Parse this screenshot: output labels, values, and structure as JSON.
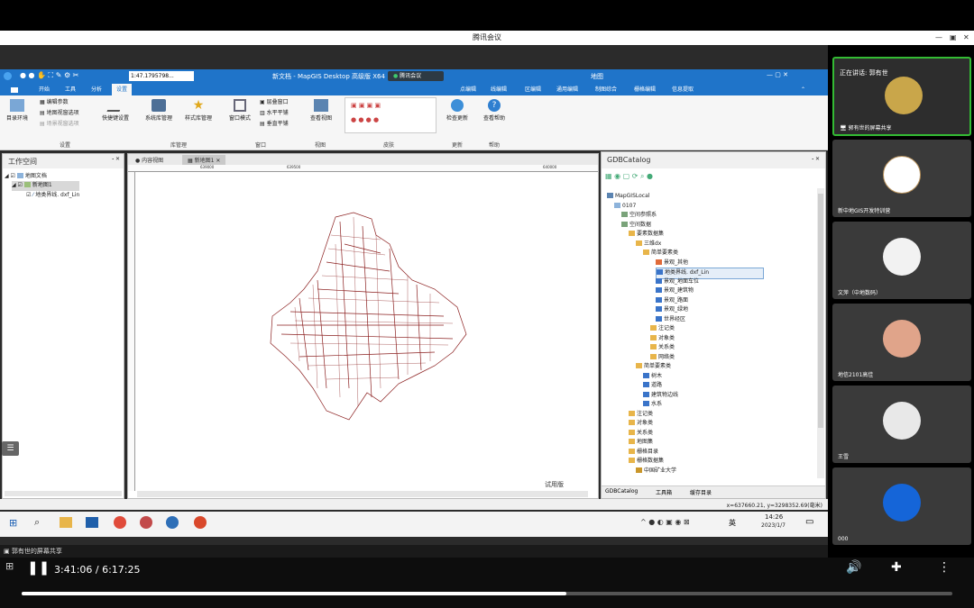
{
  "meeting": {
    "title": "腾讯会议",
    "speaking_label": "正在讲话: 郭有世",
    "sharer": "郭有世的屏幕共享",
    "sharer_bottom": "郭有世的屏幕共享"
  },
  "mapgis": {
    "window_title": "新文档 - MapGIS Desktop 高级版 X64",
    "meeting_badge": "腾讯会议",
    "right_title": "地图",
    "scale": "1:47.1795798...",
    "menu": [
      "开始",
      "工具",
      "分析",
      "设置"
    ],
    "right_menu": [
      "点编辑",
      "线编辑",
      "区编辑",
      "通用编辑",
      "制图综合",
      "栅格编辑",
      "信息提取"
    ],
    "ribbon": {
      "b1": "目录环境",
      "b2": "编辑参数",
      "b3": "地图视窗选项",
      "b4": "场景视窗选项",
      "b5": "快捷键设置",
      "b6": "系统库管理",
      "b7": "样式库管理",
      "b8": "窗口模式",
      "b9": "层叠窗口",
      "b10": "水平平铺",
      "b11": "垂直平铺",
      "b12": "查看视图",
      "b13": "检查更新",
      "b14": "查看帮助",
      "g1": "设置",
      "g2": "库管理",
      "g3": "窗口",
      "g4": "视图",
      "g5": "皮肤",
      "g6": "更新",
      "g7": "帮助"
    },
    "workspace": {
      "title": "工作空间",
      "items": [
        "地图文档",
        "新地图1",
        "地类界线. dxf_Lin"
      ]
    },
    "tabs": [
      "内容视图",
      "新地图1"
    ],
    "ruler": [
      "639000",
      "639500",
      "640000"
    ],
    "map_label": "试用版",
    "catalog": {
      "title": "GDBCatalog",
      "items": [
        "MapGISLocal",
        "0107",
        "空间参照系",
        "空间数据",
        "要素数据集",
        "三维dx",
        "简单要素类",
        "景观_其他",
        "地类界线. dxf_Lin",
        "景观_地面车位",
        "景观_建筑物",
        "景观_路面",
        "景观_绿地",
        "世界经区",
        "注记类",
        "对象类",
        "关系类",
        "网络类",
        "简单要素类",
        "树木",
        "道路",
        "建筑物边线",
        "水系",
        "注记类",
        "对象类",
        "关系类",
        "地图集",
        "栅格目录",
        "栅格数据集",
        "中国矿业大学"
      ],
      "bottom_tabs": [
        "GDBCatalog",
        "工具箱",
        "缓存目录"
      ]
    },
    "coords": "x=637660.21, y=3298352.69(毫米)"
  },
  "win_taskbar": {
    "time": "14:26",
    "date": "2023/1/7",
    "lang": "英"
  },
  "participants": [
    "郭有世的屏幕共享",
    "新中地GIS开发特训营",
    "文萍（中地数码）",
    "地信2101高佳",
    "王雪",
    "000"
  ],
  "player": {
    "time": "3:41:06 / 6:17:25",
    "progress": 0.585
  },
  "colors": {
    "blue": "#1f74c9",
    "map_line": "#8b1f1f"
  }
}
